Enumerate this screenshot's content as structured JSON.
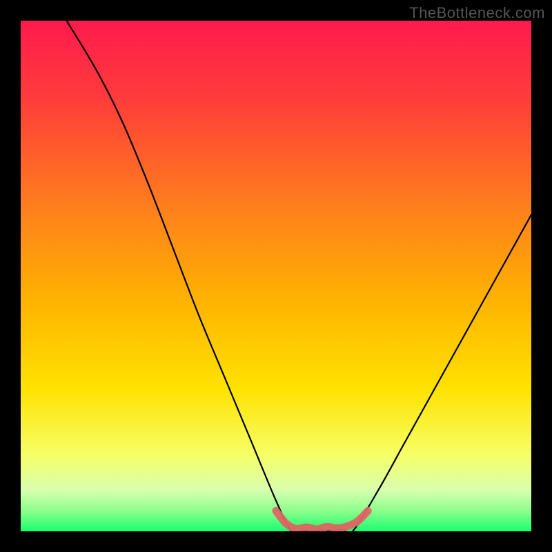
{
  "watermark": "TheBottleneck.com",
  "chart_data": {
    "type": "line",
    "title": "",
    "xlabel": "",
    "ylabel": "",
    "xlim": [
      0,
      100
    ],
    "ylim": [
      0,
      100
    ],
    "series": [
      {
        "name": "curve-left",
        "x": [
          9,
          15,
          20,
          25,
          30,
          35,
          40,
          45,
          50,
          53
        ],
        "y": [
          100,
          90,
          80,
          68,
          55,
          42,
          30,
          18,
          6,
          0
        ]
      },
      {
        "name": "flat-bottom",
        "x": [
          53,
          55,
          57,
          59,
          61,
          63,
          65
        ],
        "y": [
          0,
          0.2,
          0.0,
          0.3,
          0.1,
          0.4,
          0
        ]
      },
      {
        "name": "curve-right",
        "x": [
          65,
          70,
          75,
          80,
          85,
          90,
          95,
          100
        ],
        "y": [
          0,
          8,
          17,
          26,
          35,
          44,
          53,
          62
        ]
      }
    ],
    "highlight": {
      "name": "bottom-highlight",
      "color": "#e06464",
      "x": [
        50,
        52,
        54,
        56,
        58,
        60,
        62,
        64,
        66,
        68
      ],
      "y": [
        4,
        1.5,
        0.5,
        0.8,
        0.4,
        0.9,
        0.6,
        1.0,
        2.0,
        4
      ]
    },
    "gradient_stops": [
      {
        "offset": 0.0,
        "color": "#ff1a4d"
      },
      {
        "offset": 0.15,
        "color": "#ff3b3b"
      },
      {
        "offset": 0.35,
        "color": "#ff7a1f"
      },
      {
        "offset": 0.55,
        "color": "#ffb300"
      },
      {
        "offset": 0.72,
        "color": "#ffe200"
      },
      {
        "offset": 0.85,
        "color": "#f6ff66"
      },
      {
        "offset": 0.92,
        "color": "#d8ffb0"
      },
      {
        "offset": 0.96,
        "color": "#8cff8c"
      },
      {
        "offset": 1.0,
        "color": "#19ff70"
      }
    ]
  }
}
